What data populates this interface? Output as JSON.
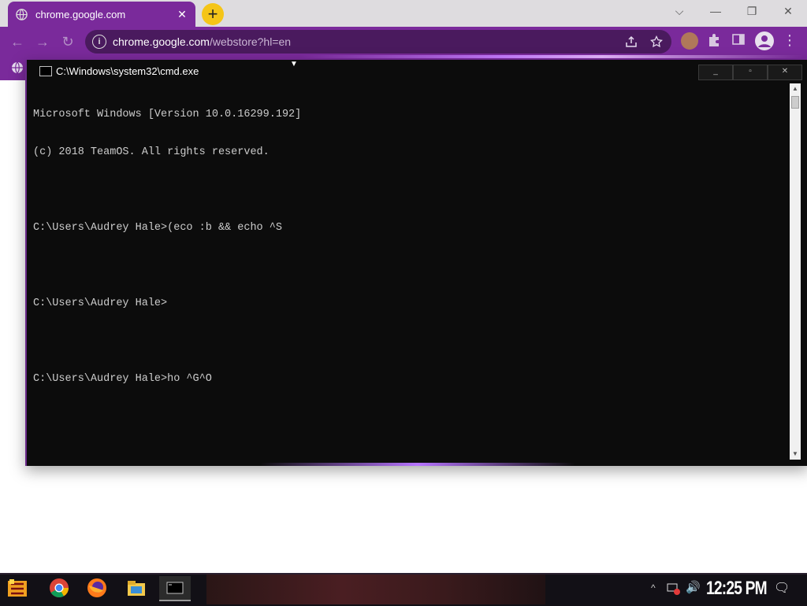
{
  "browser": {
    "tab": {
      "title": "chrome.google.com",
      "close": "✕"
    },
    "new_tab": "+",
    "window_controls": {
      "dropdown": "⌵",
      "minimize": "—",
      "restore": "❐",
      "close": "✕"
    },
    "nav": {
      "back": "←",
      "forward": "→",
      "reload": "↻"
    },
    "address": {
      "info": "i",
      "host": "chrome.google.com",
      "path": "/webstore?hl=en"
    },
    "colors": {
      "accent": "#7a2a9b",
      "omnibox": "#4a1a5e",
      "tabstrip": "#dedcdf"
    }
  },
  "cmd": {
    "title": "C:\\Windows\\system32\\cmd.exe",
    "controls": {
      "minimize": "_",
      "maximize": "▫",
      "close": "✕"
    },
    "lines": [
      "Microsoft Windows [Version 10.0.16299.192]",
      "(c) 2018 TeamOS. All rights reserved.",
      "",
      "C:\\Users\\Audrey Hale>(eco :b && echo ^S",
      "",
      "C:\\Users\\Audrey Hale>",
      "",
      "C:\\Users\\Audrey Hale>ho ^G^O"
    ]
  },
  "taskbar": {
    "clock": "12:25 PM",
    "apps": [
      "start-logo-icon",
      "chrome-icon",
      "firefox-icon",
      "file-explorer-icon",
      "cmd-icon"
    ],
    "tray": {
      "chevron": "^",
      "volume": "🔊",
      "notifications": "🗨"
    }
  }
}
